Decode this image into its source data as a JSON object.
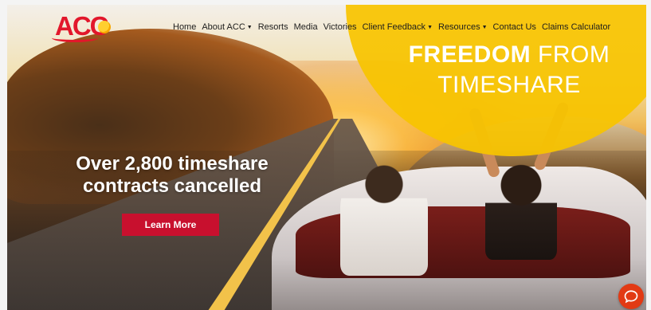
{
  "brand": {
    "logo_text": "ACC",
    "accent_red": "#c8102e",
    "accent_yellow": "#f7c400"
  },
  "nav": {
    "items": [
      {
        "label": "Home",
        "dropdown": false
      },
      {
        "label": "About ACC",
        "dropdown": true
      },
      {
        "label": "Resorts",
        "dropdown": false
      },
      {
        "label": "Media",
        "dropdown": false
      },
      {
        "label": "Victories",
        "dropdown": false
      },
      {
        "label": "Client Feedback",
        "dropdown": true
      },
      {
        "label": "Resources",
        "dropdown": true
      },
      {
        "label": "Contact Us",
        "dropdown": false
      },
      {
        "label": "Claims Calculator",
        "dropdown": false
      }
    ],
    "dropdown_icon": "caret-down-icon"
  },
  "hero": {
    "badge_line1_bold": "FREEDOM",
    "badge_line1_rest": "FROM",
    "badge_line2": "TIMESHARE",
    "title": "Over 2,800 timeshare contracts cancelled",
    "cta_label": "Learn More"
  },
  "chat": {
    "icon": "chat-bubble-icon",
    "color": "#e23a14"
  }
}
